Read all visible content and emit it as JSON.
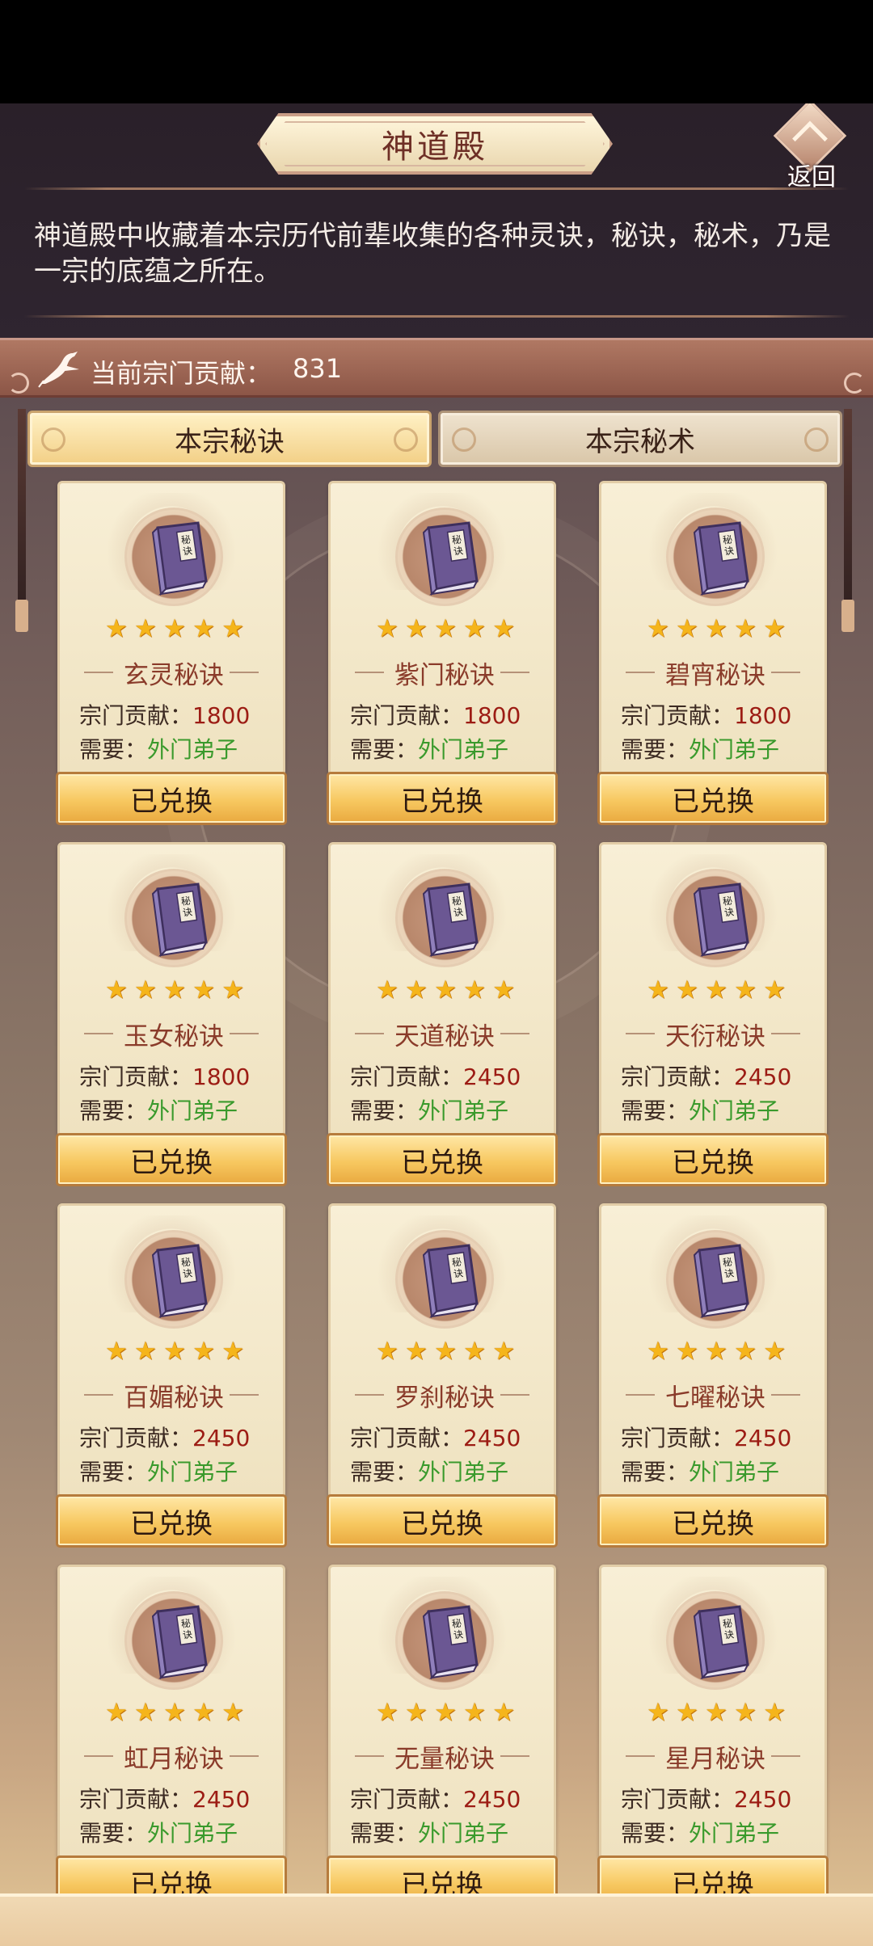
{
  "header": {
    "title": "神道殿",
    "back_label": "返回"
  },
  "intro_text": "神道殿中收藏着本宗历代前辈收集的各种灵诀，秘诀，秘术，乃是一宗的底蕴之所在。",
  "contribution": {
    "label": "当前宗门贡献：",
    "value": "831"
  },
  "tabs": [
    {
      "label": "本宗秘诀",
      "active": true
    },
    {
      "label": "本宗秘术",
      "active": false
    }
  ],
  "card_labels": {
    "cost_label": "宗门贡献：",
    "require_label": "需要："
  },
  "cards": [
    {
      "name": "玄灵秘诀",
      "cost": "1800",
      "require": "外门弟子",
      "button": "已兑换",
      "stars": 5
    },
    {
      "name": "紫门秘诀",
      "cost": "1800",
      "require": "外门弟子",
      "button": "已兑换",
      "stars": 5
    },
    {
      "name": "碧宵秘诀",
      "cost": "1800",
      "require": "外门弟子",
      "button": "已兑换",
      "stars": 5
    },
    {
      "name": "玉女秘诀",
      "cost": "1800",
      "require": "外门弟子",
      "button": "已兑换",
      "stars": 5
    },
    {
      "name": "天道秘诀",
      "cost": "2450",
      "require": "外门弟子",
      "button": "已兑换",
      "stars": 5
    },
    {
      "name": "天衍秘诀",
      "cost": "2450",
      "require": "外门弟子",
      "button": "已兑换",
      "stars": 5
    },
    {
      "name": "百媚秘诀",
      "cost": "2450",
      "require": "外门弟子",
      "button": "已兑换",
      "stars": 5
    },
    {
      "name": "罗刹秘诀",
      "cost": "2450",
      "require": "外门弟子",
      "button": "已兑换",
      "stars": 5
    },
    {
      "name": "七曜秘诀",
      "cost": "2450",
      "require": "外门弟子",
      "button": "已兑换",
      "stars": 5
    },
    {
      "name": "虹月秘诀",
      "cost": "2450",
      "require": "外门弟子",
      "button": "已兑换",
      "stars": 5
    },
    {
      "name": "无量秘诀",
      "cost": "2450",
      "require": "外门弟子",
      "button": "已兑换",
      "stars": 5
    },
    {
      "name": "星月秘诀",
      "cost": "2450",
      "require": "外门弟子",
      "button": "已兑换",
      "stars": 5
    }
  ],
  "book_icon_glyph": "秘诀",
  "colors": {
    "accent_red": "#9c1c14",
    "require_green": "#3a9a2c",
    "star": "#f5b51b",
    "book_purple": "#7e6aa8"
  },
  "icons": {
    "back": "back-arrow-icon",
    "contribution": "crane-icon",
    "item": "secret-book-icon",
    "rating": "star-icon"
  }
}
